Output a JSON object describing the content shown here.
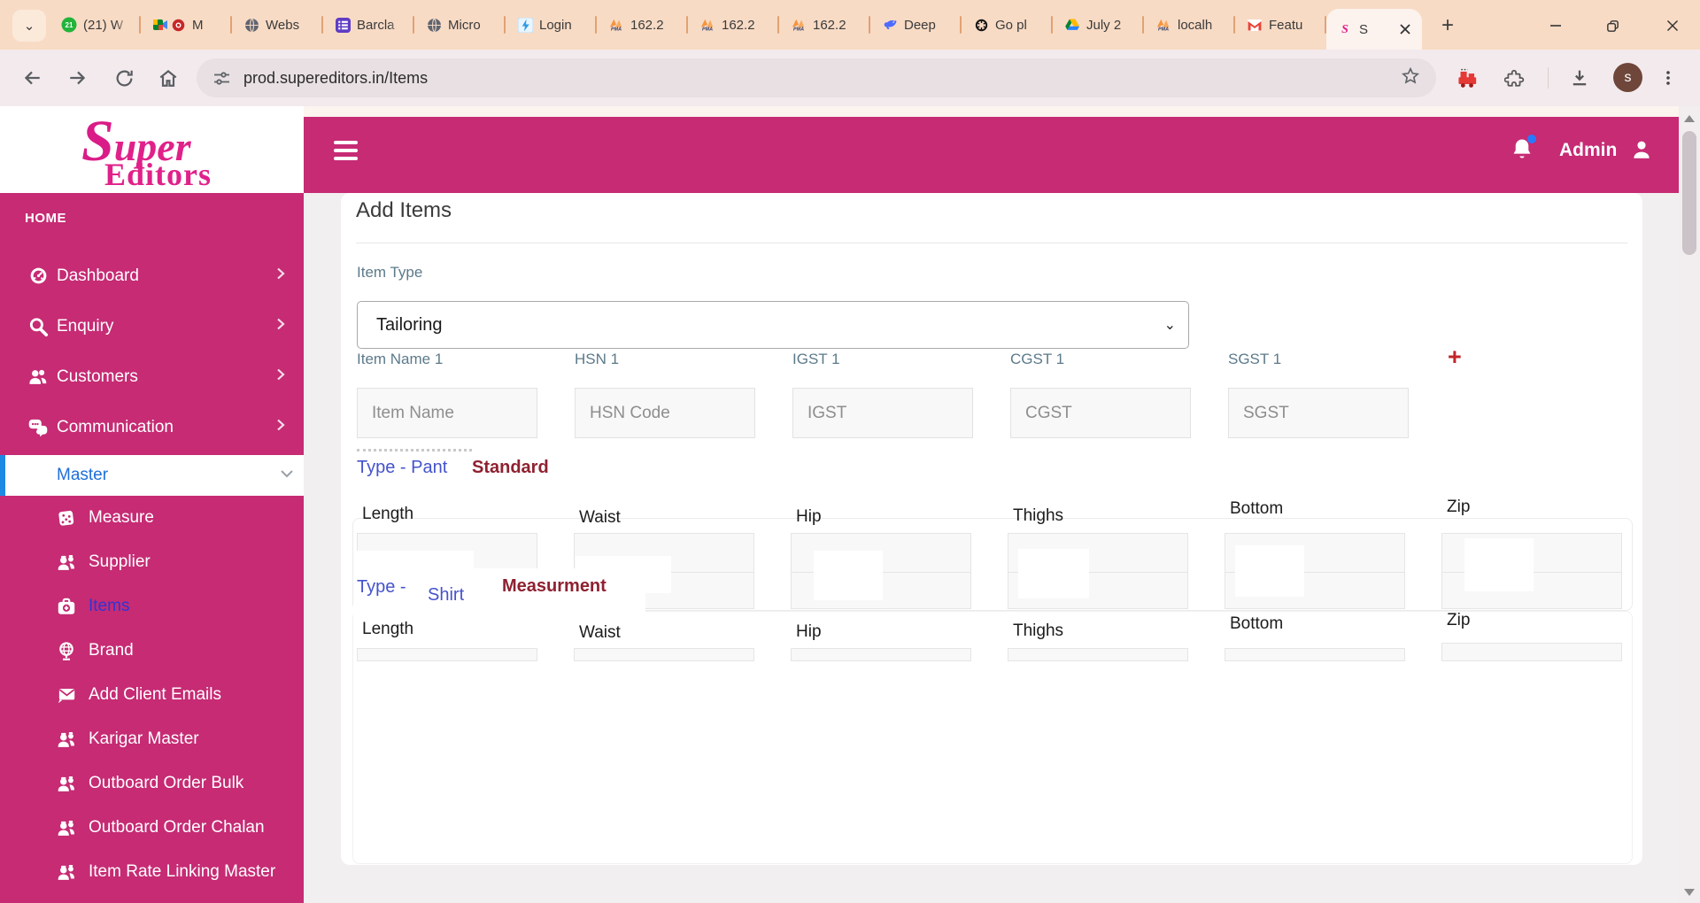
{
  "browser": {
    "tab_search_icon": "chevron-down-icon",
    "tabs": [
      {
        "label": "(21) W",
        "favicon": "whatsapp-icon"
      },
      {
        "label": "M",
        "favicon": "meet-icon",
        "extra_icon": "record-dot-icon"
      },
      {
        "label": "Webs",
        "favicon": "globe-icon"
      },
      {
        "label": "Barcla",
        "favicon": "barclays-icon"
      },
      {
        "label": "Micro",
        "favicon": "globe-icon"
      },
      {
        "label": "Login",
        "favicon": "login-icon"
      },
      {
        "label": "162.2",
        "favicon": "phpmyadmin-icon"
      },
      {
        "label": "162.2",
        "favicon": "phpmyadmin-icon"
      },
      {
        "label": "162.2",
        "favicon": "phpmyadmin-icon"
      },
      {
        "label": "Deep",
        "favicon": "deepseek-icon"
      },
      {
        "label": "Go pl",
        "favicon": "chatgpt-icon"
      },
      {
        "label": "July 2",
        "favicon": "drive-icon"
      },
      {
        "label": "localh",
        "favicon": "phpmyadmin-icon"
      },
      {
        "label": "Featu",
        "favicon": "gmail-icon"
      }
    ],
    "active_tab": {
      "label": "S",
      "favicon": "supereditors-icon"
    },
    "url": "prod.supereditors.in/Items",
    "profile_initial": "s"
  },
  "sidebar": {
    "logo_line1": "Super",
    "logo_line2": "Editors",
    "section_label": "HOME",
    "items": [
      {
        "label": "Dashboard",
        "icon": "dashboard-icon",
        "level": "top",
        "chevron": "right"
      },
      {
        "label": "Enquiry",
        "icon": "search-icon",
        "level": "top",
        "chevron": "right"
      },
      {
        "label": "Customers",
        "icon": "people-icon",
        "level": "top",
        "chevron": "right"
      },
      {
        "label": "Communication",
        "icon": "chat-icon",
        "level": "top",
        "chevron": "right"
      },
      {
        "label": "Master",
        "icon": null,
        "level": "master",
        "chevron": "down",
        "active": true
      },
      {
        "label": "Measure",
        "icon": "cube-icon",
        "level": "sub"
      },
      {
        "label": "Supplier",
        "icon": "workers-icon",
        "level": "sub"
      },
      {
        "label": "Items",
        "icon": "kit-icon",
        "level": "sub",
        "active_link": true
      },
      {
        "label": "Brand",
        "icon": "globe-stand-icon",
        "level": "sub"
      },
      {
        "label": "Add Client Emails",
        "icon": "envelope-icon",
        "level": "sub"
      },
      {
        "label": "Karigar Master",
        "icon": "workers-icon",
        "level": "sub"
      },
      {
        "label": "Outboard Order Bulk",
        "icon": "workers-icon",
        "level": "sub"
      },
      {
        "label": "Outboard Order Chalan",
        "icon": "workers-icon",
        "level": "sub"
      },
      {
        "label": "Item Rate Linking Master",
        "icon": "workers-icon",
        "level": "sub"
      }
    ]
  },
  "topbar": {
    "menu_icon": "hamburger-icon",
    "bell_icon": "bell-icon",
    "user_label": "Admin",
    "user_icon": "person-icon"
  },
  "main": {
    "title": "Add Items",
    "item_type_label": "Item Type",
    "item_type_value": "Tailoring",
    "add_label": "+",
    "gst_columns": [
      {
        "label": "Item Name 1",
        "placeholder": "Item Name"
      },
      {
        "label": "HSN 1",
        "placeholder": "HSN Code"
      },
      {
        "label": "IGST 1",
        "placeholder": "IGST"
      },
      {
        "label": "CGST 1",
        "placeholder": "CGST"
      },
      {
        "label": "SGST 1",
        "placeholder": "SGST"
      }
    ],
    "sections": [
      {
        "prefix": "Type -",
        "name": "Pant",
        "tag": "Standard",
        "fields": [
          "Length",
          "Waist",
          "Hip",
          "Thighs",
          "Bottom",
          "Zip"
        ]
      },
      {
        "prefix": "Type -",
        "name": "Shirt",
        "tag": "Measurment",
        "fields": [
          "Length",
          "Waist",
          "Hip",
          "Thighs",
          "Bottom",
          "Zip"
        ]
      }
    ]
  },
  "colors": {
    "sidebar_pink": "#C62B74",
    "logo_pink": "#E0218A",
    "active_item_blue": "#1E6FD9",
    "items_link_blue": "#2B36D8",
    "type_link_blue": "#4453CB",
    "tag_maroon": "#8E2130",
    "plus_red": "#C3242B",
    "tabstrip_peach": "#F8DBC5",
    "notification_dot_blue": "#2979FF"
  }
}
